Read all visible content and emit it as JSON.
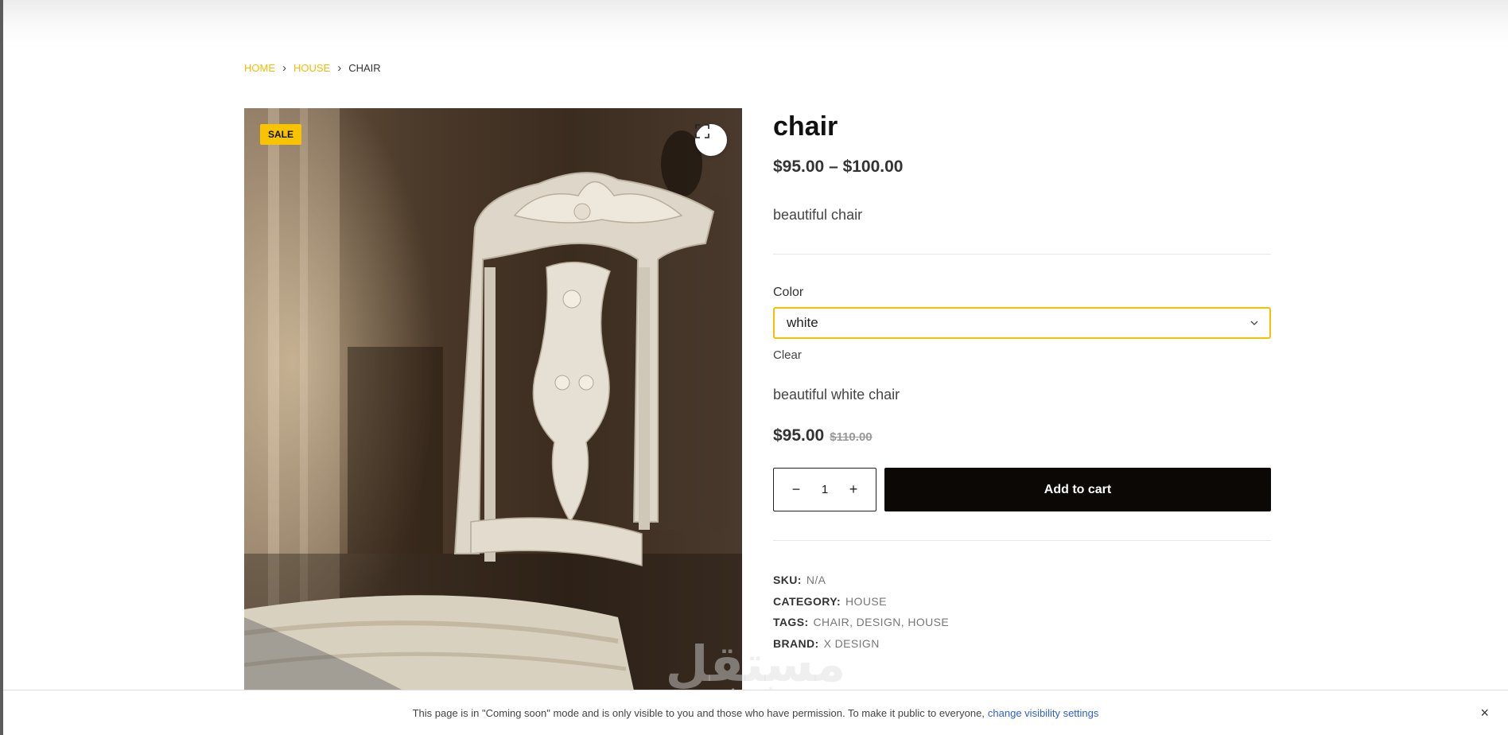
{
  "breadcrumb": {
    "home": "HOME",
    "category": "HOUSE",
    "current": "CHAIR",
    "separator": "›"
  },
  "product": {
    "sale_badge": "SALE",
    "title": "chair",
    "price_range": "$95.00 – $100.00",
    "short_description": "beautiful chair",
    "zoom_icon": "fullscreen-icon"
  },
  "variation": {
    "label": "Color",
    "selected": "white",
    "clear_label": "Clear",
    "description": "beautiful white chair",
    "price_now": "$95.00",
    "price_was": "$110.00"
  },
  "cart": {
    "minus": "−",
    "quantity": "1",
    "plus": "+",
    "add_label": "Add to cart"
  },
  "meta": {
    "sku_label": "SKU:",
    "sku_value": "N/A",
    "category_label": "CATEGORY:",
    "category_value": "HOUSE",
    "tags_label": "TAGS:",
    "tags": [
      "CHAIR",
      "DESIGN",
      "HOUSE"
    ],
    "brand_label": "BRAND:",
    "brand_value": "X DESIGN"
  },
  "watermark": {
    "arabic": "مستقل",
    "latin": "mostaql.com"
  },
  "notice": {
    "text": "This page is in \"Coming soon\" mode and is only visible to you and those who have permission. To make it public to everyone,",
    "link": "change visibility settings",
    "close": "×"
  },
  "colors": {
    "accent": "#f2bb05",
    "button_bg": "#0c0805",
    "link": "#2f5fd0"
  }
}
